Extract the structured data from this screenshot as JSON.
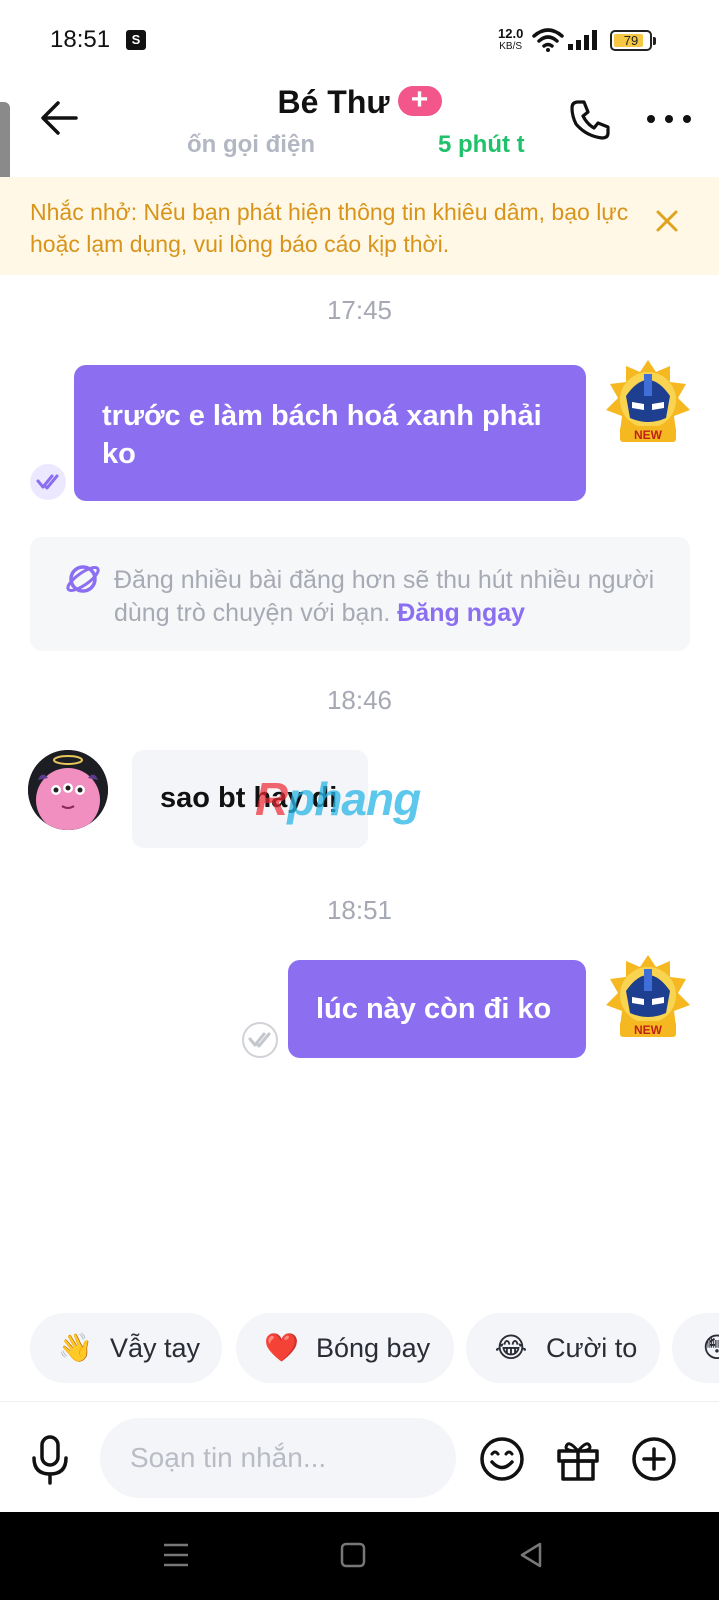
{
  "status_bar": {
    "time": "18:51",
    "speed_value": "12.0",
    "speed_unit": "KB/S",
    "battery": "79",
    "battery_level": 0.79,
    "icons": [
      "shopee-icon",
      "wifi-icon",
      "signal-icon",
      "battery-icon"
    ]
  },
  "header": {
    "contact_name": "Bé Thư",
    "badge_symbol": "+",
    "sub_left": "ốn gọi điện",
    "sub_right": "5 phút t"
  },
  "reminder": {
    "text": "Nhắc nhở: Nếu bạn phát hiện thông tin khiêu dâm, bạo lực hoặc lạm dụng, vui lòng báo cáo kịp thời."
  },
  "messages": {
    "ts1": "17:45",
    "msg1": "trước e làm bách hoá xanh phải ko",
    "badge_label": "NEW",
    "tip_text": "Đăng nhiều bài đăng hơn sẽ thu hút nhiều người dùng trò chuyện với bạn.",
    "tip_link": "Đăng ngay",
    "ts2": "18:46",
    "msg2": "sao bt hay dị",
    "ts3": "18:51",
    "msg3": "lúc này còn đi ko"
  },
  "watermark": {
    "r": "R",
    "rest": "phang"
  },
  "quick_replies": [
    {
      "emoji": "👋",
      "label": "Vẫy tay"
    },
    {
      "emoji": "❤️",
      "label": "Bóng bay"
    },
    {
      "emoji": "😂",
      "label": "Cười to"
    },
    {
      "emoji": "😳",
      "label": ""
    }
  ],
  "composer": {
    "placeholder": "Soạn tin nhắn..."
  },
  "colors": {
    "accent": "#8b6ff0",
    "reminder_bg": "#fff8e6",
    "reminder_text": "#d8941a",
    "online_green": "#1fc26b",
    "badge_pink": "#f2568b"
  }
}
